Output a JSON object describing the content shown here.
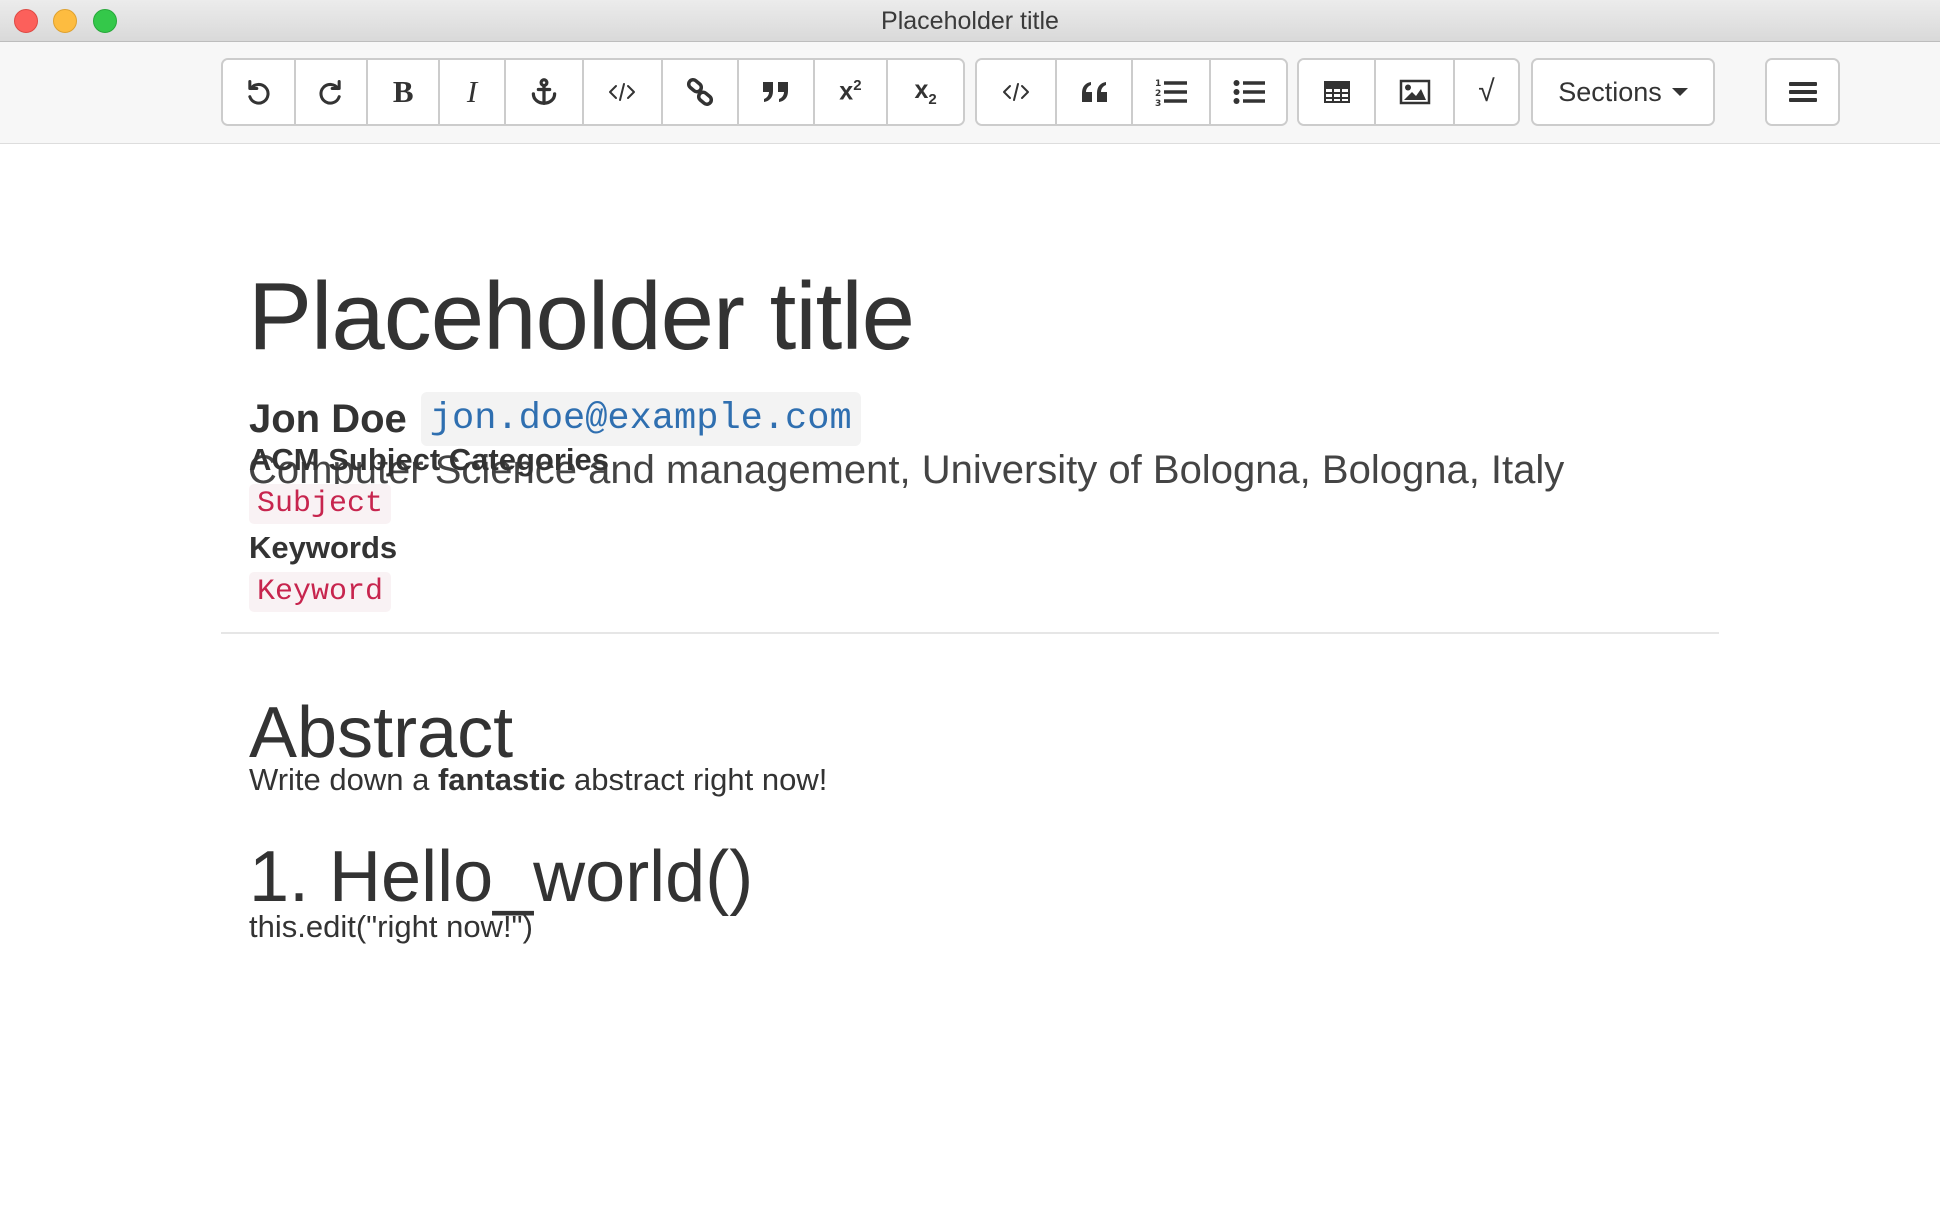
{
  "window": {
    "title": "Placeholder title"
  },
  "toolbar": {
    "groups": [
      [
        "undo-icon",
        "redo-icon",
        "bold-icon",
        "italic-icon",
        "anchor-icon",
        "inline-code-icon",
        "link-icon",
        "quote-icon",
        "superscript-icon",
        "subscript-icon"
      ],
      [
        "code-block-icon",
        "blockquote-icon",
        "ordered-list-icon",
        "unordered-list-icon"
      ],
      [
        "table-icon",
        "image-icon",
        "formula-icon"
      ]
    ],
    "bold_label": "B",
    "italic_label": "I",
    "formula_label": "√",
    "sections_label": "Sections",
    "menu_icon": "hamburger-menu-icon"
  },
  "document": {
    "title": "Placeholder title",
    "author": {
      "name": "Jon Doe",
      "email": "jon.doe@example.com",
      "affiliation": "Computer Science and management, University of Bologna, Bologna, Italy"
    },
    "acm": {
      "heading": "ACM Subject Categories",
      "value": "Subject"
    },
    "keywords": {
      "heading": "Keywords",
      "value": "Keyword"
    },
    "abstract": {
      "heading": "Abstract",
      "text_before": "Write down a ",
      "text_bold": "fantastic",
      "text_after": " abstract right now!"
    },
    "section": {
      "heading": "1. Hello_world()",
      "text": "this.edit(\"right now!\")"
    }
  }
}
